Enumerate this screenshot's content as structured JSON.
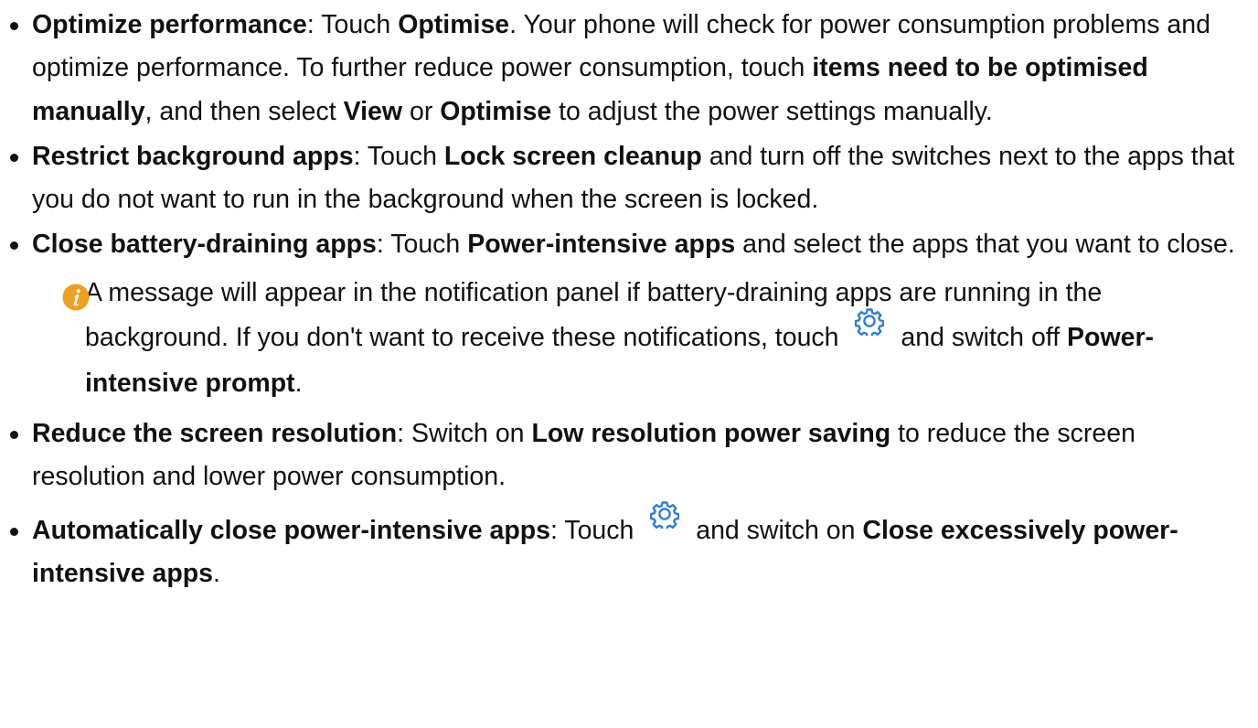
{
  "tips": [
    {
      "title": "Optimize performance",
      "parts": [
        {
          "t": "n",
          "s": ": Touch "
        },
        {
          "t": "b",
          "s": "Optimise"
        },
        {
          "t": "n",
          "s": ". Your phone will check for power consumption problems and optimize performance. To further reduce power consumption, touch "
        },
        {
          "t": "b",
          "s": "items need to be optimised manually"
        },
        {
          "t": "n",
          "s": ", and then select "
        },
        {
          "t": "b",
          "s": "View"
        },
        {
          "t": "n",
          "s": " or "
        },
        {
          "t": "b",
          "s": "Optimise"
        },
        {
          "t": "n",
          "s": " to adjust the power settings manually."
        }
      ]
    },
    {
      "title": "Restrict background apps",
      "parts": [
        {
          "t": "n",
          "s": ": Touch "
        },
        {
          "t": "b",
          "s": "Lock screen cleanup"
        },
        {
          "t": "n",
          "s": " and turn off the switches next to the apps that you do not want to run in the background when the screen is locked."
        }
      ]
    },
    {
      "title": "Close battery-draining apps",
      "parts": [
        {
          "t": "n",
          "s": ": Touch "
        },
        {
          "t": "b",
          "s": "Power-intensive apps"
        },
        {
          "t": "n",
          "s": " and select the apps that you want to close."
        }
      ],
      "note": {
        "icon": "info-icon",
        "parts": [
          {
            "t": "n",
            "s": "A message will appear in the notification panel if battery-draining apps are running in the background. If you don't want to receive these notifications, touch "
          },
          {
            "t": "icon",
            "s": "gear-icon"
          },
          {
            "t": "n",
            "s": " and switch off "
          },
          {
            "t": "b",
            "s": "Power-intensive prompt"
          },
          {
            "t": "n",
            "s": "."
          }
        ]
      }
    },
    {
      "title": "Reduce the screen resolution",
      "parts": [
        {
          "t": "n",
          "s": ": Switch on "
        },
        {
          "t": "b",
          "s": "Low resolution power saving"
        },
        {
          "t": "n",
          "s": " to reduce the screen resolution and lower power consumption."
        }
      ]
    },
    {
      "title": "Automatically close power-intensive apps",
      "parts": [
        {
          "t": "n",
          "s": ": Touch "
        },
        {
          "t": "icon",
          "s": "gear-icon"
        },
        {
          "t": "n",
          "s": " and switch on "
        },
        {
          "t": "b",
          "s": "Close excessively power-intensive apps"
        },
        {
          "t": "n",
          "s": "."
        }
      ]
    }
  ],
  "colors": {
    "text": "#111111",
    "info_icon": "#f0a020",
    "gear_icon": "#2e7cd6"
  }
}
